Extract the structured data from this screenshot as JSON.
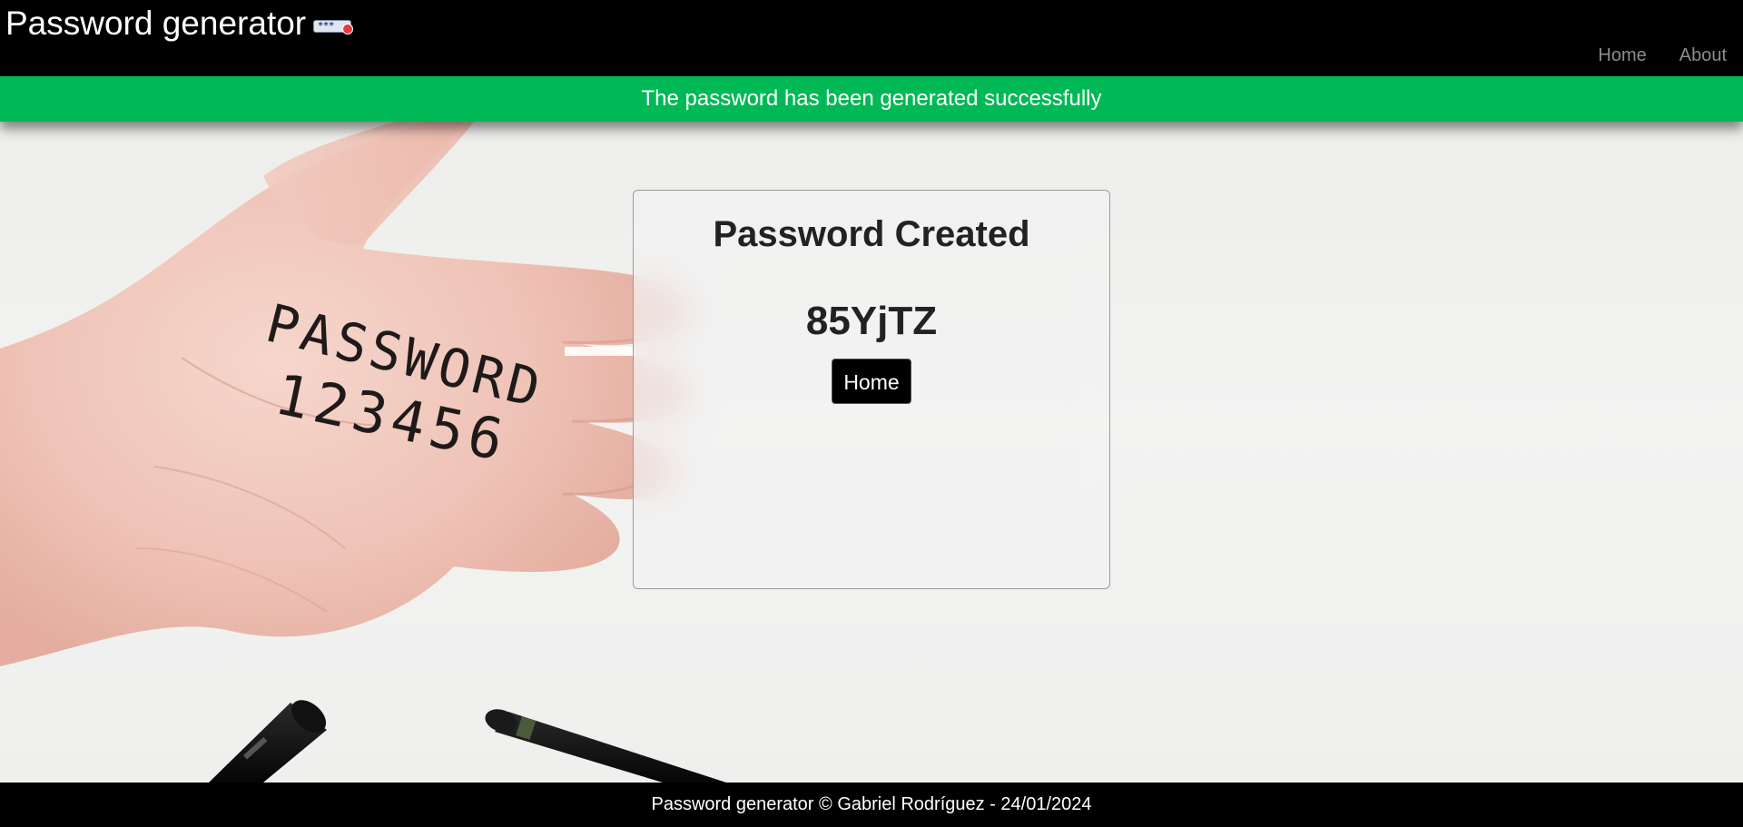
{
  "header": {
    "brand_title": "Password generator",
    "brand_icon": "password-field-icon",
    "brand_icon_text": "***",
    "nav": [
      {
        "label": "Home"
      },
      {
        "label": "About"
      }
    ]
  },
  "alert": {
    "message": "The password has been generated successfully",
    "color": "#00b956"
  },
  "background": {
    "handwriting_line1": "PASSWORD",
    "handwriting_line2": "123456"
  },
  "card": {
    "title": "Password Created",
    "password": "85YjTZ",
    "home_button_label": "Home"
  },
  "footer": {
    "text": "Password generator © Gabriel Rodríguez - 24/01/2024"
  }
}
